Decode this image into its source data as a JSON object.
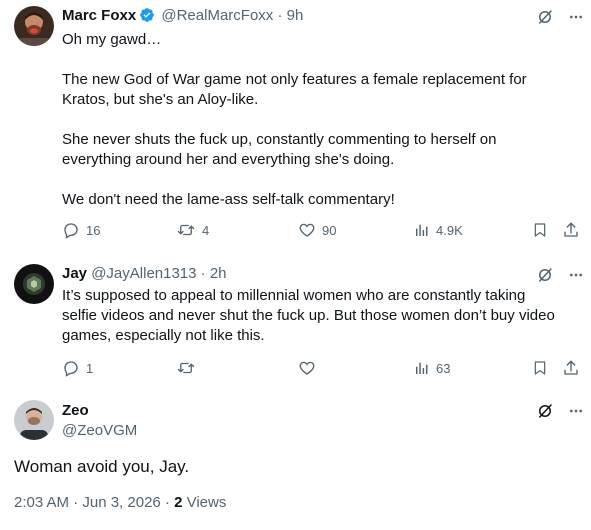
{
  "tweets": [
    {
      "name": "Marc Foxx",
      "handle": "@RealMarcFoxx",
      "sep": "·",
      "time": "9h",
      "text": "Oh my gawd…\n\nThe new God of War game not only features a female replacement for\nKratos, but she's an Aloy-like.\n\nShe never shuts the fuck up, constantly commenting to herself on\neverything around her and everything she's doing.\n\nWe don't need the lame-ass self-talk commentary!",
      "replies": "16",
      "reposts": "4",
      "likes": "90",
      "views": "4.9K"
    },
    {
      "name": "Jay",
      "handle": "@JayAllen1313",
      "sep": "·",
      "time": "2h",
      "text": "It’s supposed to appeal to millennial women who are constantly taking\nselfie videos and never shut the fuck up. But those women don’t buy video\ngames, especially not like this.",
      "replies": "1",
      "views": "63"
    }
  ],
  "main": {
    "name": "Zeo",
    "handle": "@ZeoVGM",
    "text": "Woman avoid you, Jay.",
    "timestamp": "2:03 AM · Jun 3, 2026 · ",
    "views_count": "2",
    "views_label": " Views"
  },
  "colors": {
    "verified": "#1d9bf0",
    "muted": "#536471",
    "text": "#0f1419"
  }
}
